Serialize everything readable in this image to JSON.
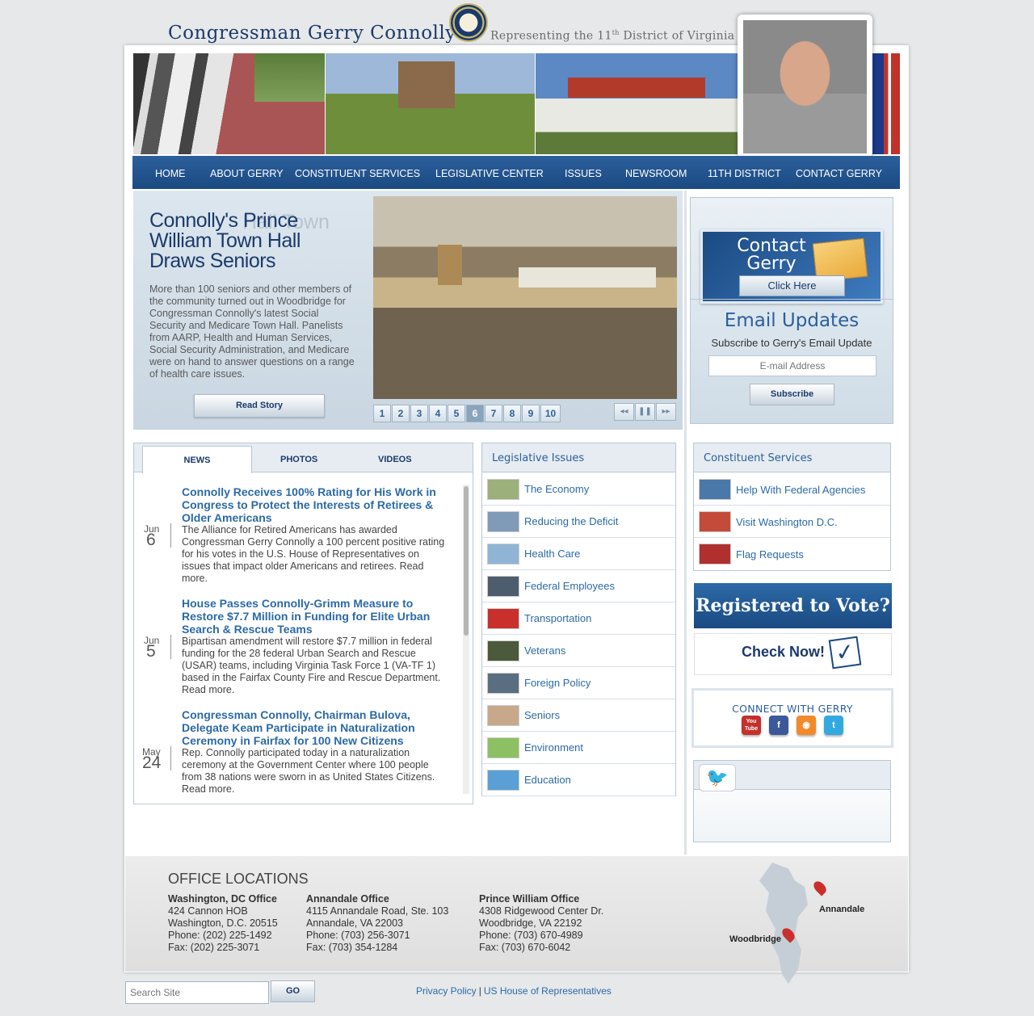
{
  "header": {
    "title": "Congressman Gerry Connolly",
    "tagline_prefix": "Representing the 11",
    "tagline_sup": "th",
    "tagline_suffix": " District of Virginia"
  },
  "nav": [
    "HOME",
    "ABOUT GERRY",
    "CONSTITUENT SERVICES",
    "LEGISLATIVE CENTER",
    "ISSUES",
    "NEWSROOM",
    "11TH DISTRICT",
    "CONTACT GERRY"
  ],
  "feature": {
    "title": "Connolly's Prince William Town Hall Draws Seniors",
    "ghost_title": "Hall Town",
    "body": "More than 100 seniors and other members of the community turned out in Woodbridge for Congressman Connolly's latest Social Security and Medicare Town Hall. Panelists from AARP, Health and Human Services, Social Security Administration, and Medicare were on hand to answer questions on a range of health care issues.",
    "read_story": "Read Story",
    "pages": [
      "1",
      "2",
      "3",
      "4",
      "5",
      "6",
      "7",
      "8",
      "9",
      "10"
    ],
    "active_page": "6",
    "controls": {
      "prev": "◂◂",
      "pause": "❚❚",
      "next": "▸▸"
    }
  },
  "contact": {
    "title": "Contact Gerry",
    "click_here": "Click Here"
  },
  "email_updates": {
    "title": "Email Updates",
    "subtitle": "Subscribe to Gerry's Email Update",
    "placeholder": "E-mail Address",
    "subscribe": "Subscribe"
  },
  "news": {
    "tabs": [
      "NEWS",
      "PHOTOS",
      "VIDEOS"
    ],
    "items": [
      {
        "month": "Jun",
        "day": "6",
        "title": "Connolly Receives 100% Rating for His Work in Congress to Protect the Interests of Retirees & Older Americans",
        "body": "The Alliance for Retired Americans has awarded Congressman Gerry Connolly a 100 percent positive rating for his votes in the U.S. House of Representatives on issues that impact older Americans and retirees. Read more."
      },
      {
        "month": "Jun",
        "day": "5",
        "title": "House Passes Connolly-Grimm Measure to Restore $7.7 Million in Funding for Elite Urban Search & Rescue Teams",
        "body": "Bipartisan amendment will restore $7.7 million in federal funding for the 28 federal Urban Search and Rescue (USAR) teams, including Virginia Task Force 1 (VA-TF 1) based in the Fairfax County Fire and Rescue Department. Read more."
      },
      {
        "month": "May",
        "day": "24",
        "title": "Congressman Connolly, Chairman Bulova, Delegate Keam Participate in Naturalization Ceremony in Fairfax for 100 New Citizens",
        "body": "Rep. Connolly participated today in a naturalization ceremony at the Government Center where 100 people from 38 nations were sworn in as United States Citizens. Read more."
      }
    ]
  },
  "legislative": {
    "title": "Legislative Issues",
    "items": [
      "The Economy",
      "Reducing the Deficit",
      "Health Care",
      "Federal Employees",
      "Transportation",
      "Veterans",
      "Foreign Policy",
      "Seniors",
      "Environment",
      "Education"
    ]
  },
  "constituent": {
    "title": "Constituent Services",
    "items": [
      "Help With Federal Agencies",
      "Visit Washington D.C.",
      "Flag Requests"
    ]
  },
  "vote": {
    "headline": "Registered to Vote?",
    "cta": "Check Now!"
  },
  "connect": {
    "title": "CONNECT WITH GERRY",
    "networks": [
      {
        "name": "YouTube",
        "glyph": "You\nTube",
        "color": "#c4302b"
      },
      {
        "name": "Facebook",
        "glyph": "f",
        "color": "#3b5998"
      },
      {
        "name": "RSS",
        "glyph": "◉",
        "color": "#f2892b"
      },
      {
        "name": "Twitter",
        "glyph": "t",
        "color": "#33a9e0"
      }
    ]
  },
  "offices": {
    "title": "OFFICE LOCATIONS",
    "list": [
      {
        "name": "Washington, DC Office",
        "line1": "424 Cannon HOB",
        "line2": "Washington, D.C. 20515",
        "phone": "Phone: (202) 225-1492",
        "fax": "Fax: (202) 225-3071"
      },
      {
        "name": "Annandale Office",
        "line1": "4115 Annandale Road, Ste. 103",
        "line2": "Annandale, VA 22003",
        "phone": "Phone: (703) 256-3071",
        "fax": "Fax: (703) 354-1284"
      },
      {
        "name": "Prince William Office",
        "line1": "4308 Ridgewood Center Dr.",
        "line2": "Woodbridge, VA 22192",
        "phone": "Phone: (703) 670-4989",
        "fax": "Fax: (703) 670-6042"
      }
    ],
    "map_labels": [
      "Annandale",
      "Woodbridge"
    ]
  },
  "footer": {
    "search_placeholder": "Search Site",
    "go": "GO",
    "privacy": "Privacy Policy",
    "house": "US House of Representatives",
    "separator": "|"
  },
  "colors": {
    "brand_blue": "#1b4a82",
    "link_blue": "#2c6aa6",
    "panel_bg": "#e6ecf1"
  }
}
